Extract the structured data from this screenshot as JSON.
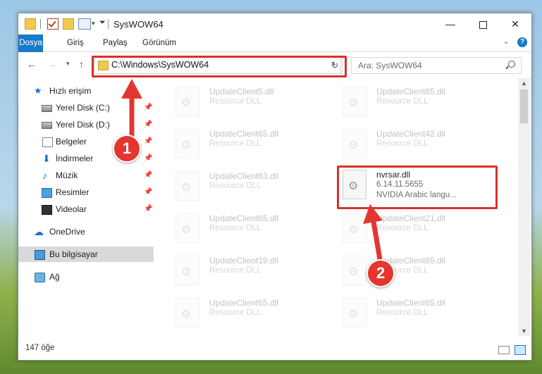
{
  "window": {
    "title": "SysWOW64",
    "controls": {
      "minimize": "—",
      "close": "✕"
    }
  },
  "ribbon": {
    "tabs": [
      "Dosya",
      "Giriş",
      "Paylaş",
      "Görünüm"
    ],
    "help": "?"
  },
  "navbar": {
    "address": "C:\\Windows\\SysWOW64",
    "search_placeholder": "Ara: SysWOW64"
  },
  "sidebar": {
    "items": [
      {
        "label": "Hızlı erişim",
        "icon": "star-icon"
      },
      {
        "label": "Yerel Disk (C:)",
        "icon": "drive-icon",
        "pinned": true
      },
      {
        "label": "Yerel Disk (D:)",
        "icon": "drive-icon",
        "pinned": true
      },
      {
        "label": "Belgeler",
        "icon": "documents-icon",
        "pinned": true
      },
      {
        "label": "İndirmeler",
        "icon": "download-icon",
        "pinned": true
      },
      {
        "label": "Müzik",
        "icon": "music-icon",
        "pinned": true
      },
      {
        "label": "Resimler",
        "icon": "pictures-icon",
        "pinned": true
      },
      {
        "label": "Videolar",
        "icon": "videos-icon",
        "pinned": true
      },
      {
        "label": "OneDrive",
        "icon": "cloud-icon"
      },
      {
        "label": "Bu bilgisayar",
        "icon": "computer-icon",
        "selected": true
      },
      {
        "label": "Ağ",
        "icon": "network-icon"
      }
    ]
  },
  "files": [
    {
      "name": "UpdateClient5.dll",
      "type": "Resource DLL"
    },
    {
      "name": "UpdateClient65.dll",
      "type": "Resource DLL"
    },
    {
      "name": "UpdateClient65.dll",
      "type": "Resource DLL"
    },
    {
      "name": "UpdateClient42.dll",
      "type": "Resource DLL"
    },
    {
      "name": "UpdateClient63.dll",
      "type": "Resource DLL"
    },
    {
      "name": "nvrsar.dll",
      "version": "6.14.11.5655",
      "description": "NVIDIA Arabic langu..."
    },
    {
      "name": "UpdateClient65.dll",
      "type": "Resource DLL"
    },
    {
      "name": "UpdateClient21.dll",
      "type": "Resource DLL"
    },
    {
      "name": "UpdateClient19.dll",
      "type": "Resource DLL"
    },
    {
      "name": "UpdateClient65.dll",
      "type": "Resource DLL"
    },
    {
      "name": "UpdateClient65.dll",
      "type": "Resource DLL"
    },
    {
      "name": "UpdateClient65.dll",
      "type": "Resource DLL"
    }
  ],
  "status": {
    "item_count": "147 öğe"
  },
  "annotations": {
    "badge1": "1",
    "badge2": "2",
    "color": "#e4362f"
  }
}
